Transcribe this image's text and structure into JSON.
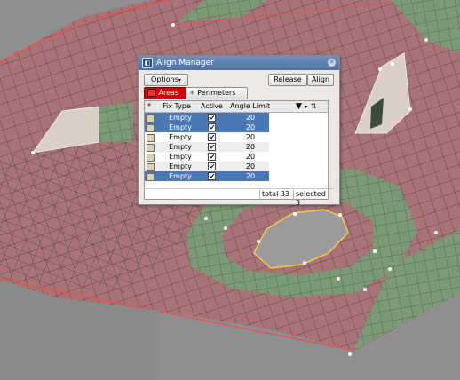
{
  "dialog": {
    "title": "Align Manager",
    "options_label": "Options",
    "release_label": "Release",
    "align_label": "Align",
    "areas_label": "Areas",
    "perimeters_label": "Perimeters"
  },
  "table": {
    "sort_marker": "*",
    "headers": {
      "fix_type": "Fix Type",
      "active": "Active",
      "angle_limit": "Angle Limit"
    },
    "rows": [
      {
        "fix_type": "Empty",
        "active": true,
        "angle_limit": "20",
        "selected": true
      },
      {
        "fix_type": "Empty",
        "active": true,
        "angle_limit": "20",
        "selected": true
      },
      {
        "fix_type": "Empty",
        "active": true,
        "angle_limit": "20",
        "selected": false
      },
      {
        "fix_type": "Empty",
        "active": true,
        "angle_limit": "20",
        "selected": false
      },
      {
        "fix_type": "Empty",
        "active": true,
        "angle_limit": "20",
        "selected": false
      },
      {
        "fix_type": "Empty",
        "active": true,
        "angle_limit": "20",
        "selected": false
      },
      {
        "fix_type": "Empty",
        "active": true,
        "angle_limit": "20",
        "selected": true
      }
    ]
  },
  "status": {
    "total": "total 33",
    "selected": "selected 3"
  },
  "colors": {
    "title_bar": "#5a7db0",
    "selection": "#4a78b5",
    "areas_button": "#d50000",
    "mesh_surface": "#a87478",
    "mesh_selected": "#7d9a76",
    "hole": "#9c9c9c"
  }
}
